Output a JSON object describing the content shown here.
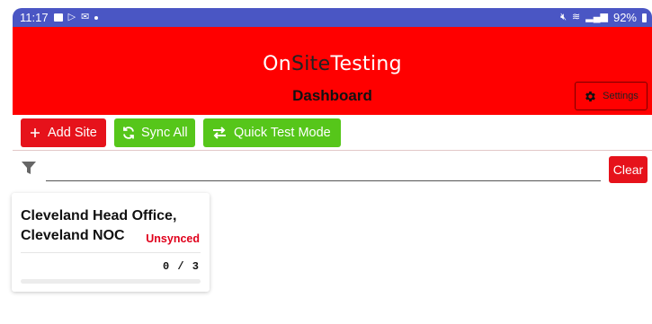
{
  "statusbar": {
    "time": "11:17",
    "battery": "92%",
    "signal_label": "Vo LTE"
  },
  "header": {
    "app_title_part1": "On",
    "app_title_part2": "Site",
    "app_title_part3": "Testing",
    "page_title": "Dashboard",
    "settings_label": "Settings"
  },
  "toolbar": {
    "add_site_label": "Add Site",
    "sync_all_label": "Sync All",
    "quick_test_label": "Quick Test Mode"
  },
  "filter": {
    "value": "",
    "clear_label": "Clear"
  },
  "sites": [
    {
      "name": "Cleveland Head Office, Cleveland NOC",
      "status": "Unsynced",
      "progress_text": "0 / 3",
      "completed": 0,
      "total": 3
    }
  ],
  "colors": {
    "primary_red": "#ff0000",
    "button_red": "#e6121b",
    "button_green": "#56c61a",
    "status_bar": "#4a56c4",
    "unsynced": "#e0001b"
  }
}
